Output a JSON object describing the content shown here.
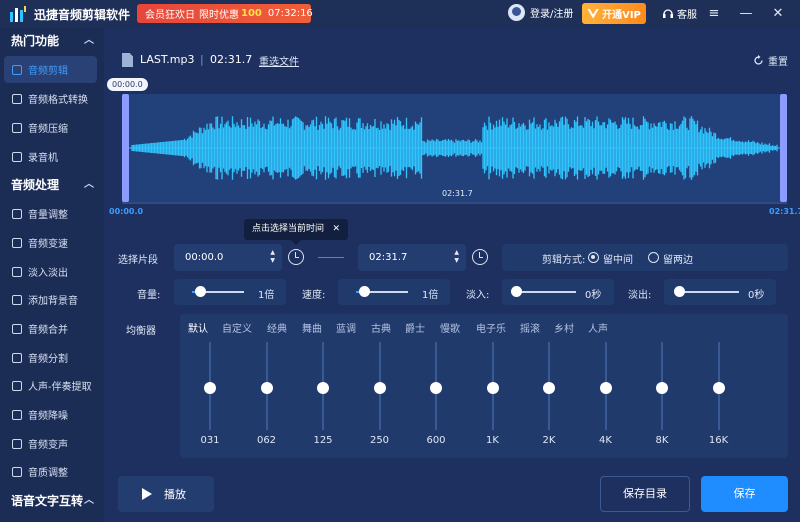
{
  "app": {
    "title": "迅捷音频剪辑软件"
  },
  "promo": {
    "text": "会员狂欢日",
    "offer": "限时优惠",
    "num": "100",
    "time": "07:32:16"
  },
  "header": {
    "login": "登录/注册",
    "vip": "开通VIP",
    "service": "客服"
  },
  "sidebar": {
    "sections": [
      {
        "label": "热门功能"
      },
      {
        "label": "音频处理"
      },
      {
        "label": "语音文字互转"
      }
    ],
    "hot_items": [
      {
        "label": "音频剪辑"
      },
      {
        "label": "音频格式转换"
      },
      {
        "label": "音频压缩"
      },
      {
        "label": "录音机"
      }
    ],
    "proc_items": [
      {
        "label": "音量调整"
      },
      {
        "label": "音频变速"
      },
      {
        "label": "淡入淡出"
      },
      {
        "label": "添加背景音"
      },
      {
        "label": "音频合并"
      },
      {
        "label": "音频分割"
      },
      {
        "label": "人声-伴奏提取"
      },
      {
        "label": "音频降噪"
      },
      {
        "label": "音频变声"
      },
      {
        "label": "音质调整"
      }
    ]
  },
  "file": {
    "name": "LAST.mp3",
    "sep": "|",
    "duration": "02:31.7",
    "reselect": "重选文件",
    "reset": "重置"
  },
  "timeline": {
    "start_badge": "00:00.0",
    "mid": "02:31.7",
    "left": "00:00.0",
    "right": "02:31.7"
  },
  "tooltip": {
    "text": "点击选择当前时间",
    "close": "✕"
  },
  "segment": {
    "label": "选择片段",
    "start": "00:00.0",
    "end": "02:31.7"
  },
  "mode": {
    "label": "剪辑方式:",
    "opt_middle": "留中间",
    "opt_sides": "留两边",
    "selected": "留中间"
  },
  "sliders": [
    {
      "label": "音量:",
      "value": "1倍",
      "level": 0.15
    },
    {
      "label": "速度:",
      "value": "1倍",
      "level": 0.15
    },
    {
      "label": "淡入:",
      "value": "0秒",
      "level": 0
    },
    {
      "label": "淡出:",
      "value": "0秒",
      "level": 0
    }
  ],
  "eq": {
    "label": "均衡器",
    "presets": [
      "默认",
      "自定义",
      "经典",
      "舞曲",
      "蓝调",
      "古典",
      "爵士",
      "慢歌",
      "电子乐",
      "摇滚",
      "乡村",
      "人声"
    ],
    "selected": "默认",
    "bands": [
      "031",
      "062",
      "125",
      "250",
      "600",
      "1K",
      "2K",
      "4K",
      "8K",
      "16K"
    ]
  },
  "actions": {
    "play": "播放",
    "save_dir": "保存目录",
    "save": "保存"
  },
  "colors": {
    "accent": "#1f8cff",
    "wave": "#2fc6ff",
    "handle": "#8b9bff",
    "promo": "#e8453a",
    "vip": "#ff9a2a"
  }
}
